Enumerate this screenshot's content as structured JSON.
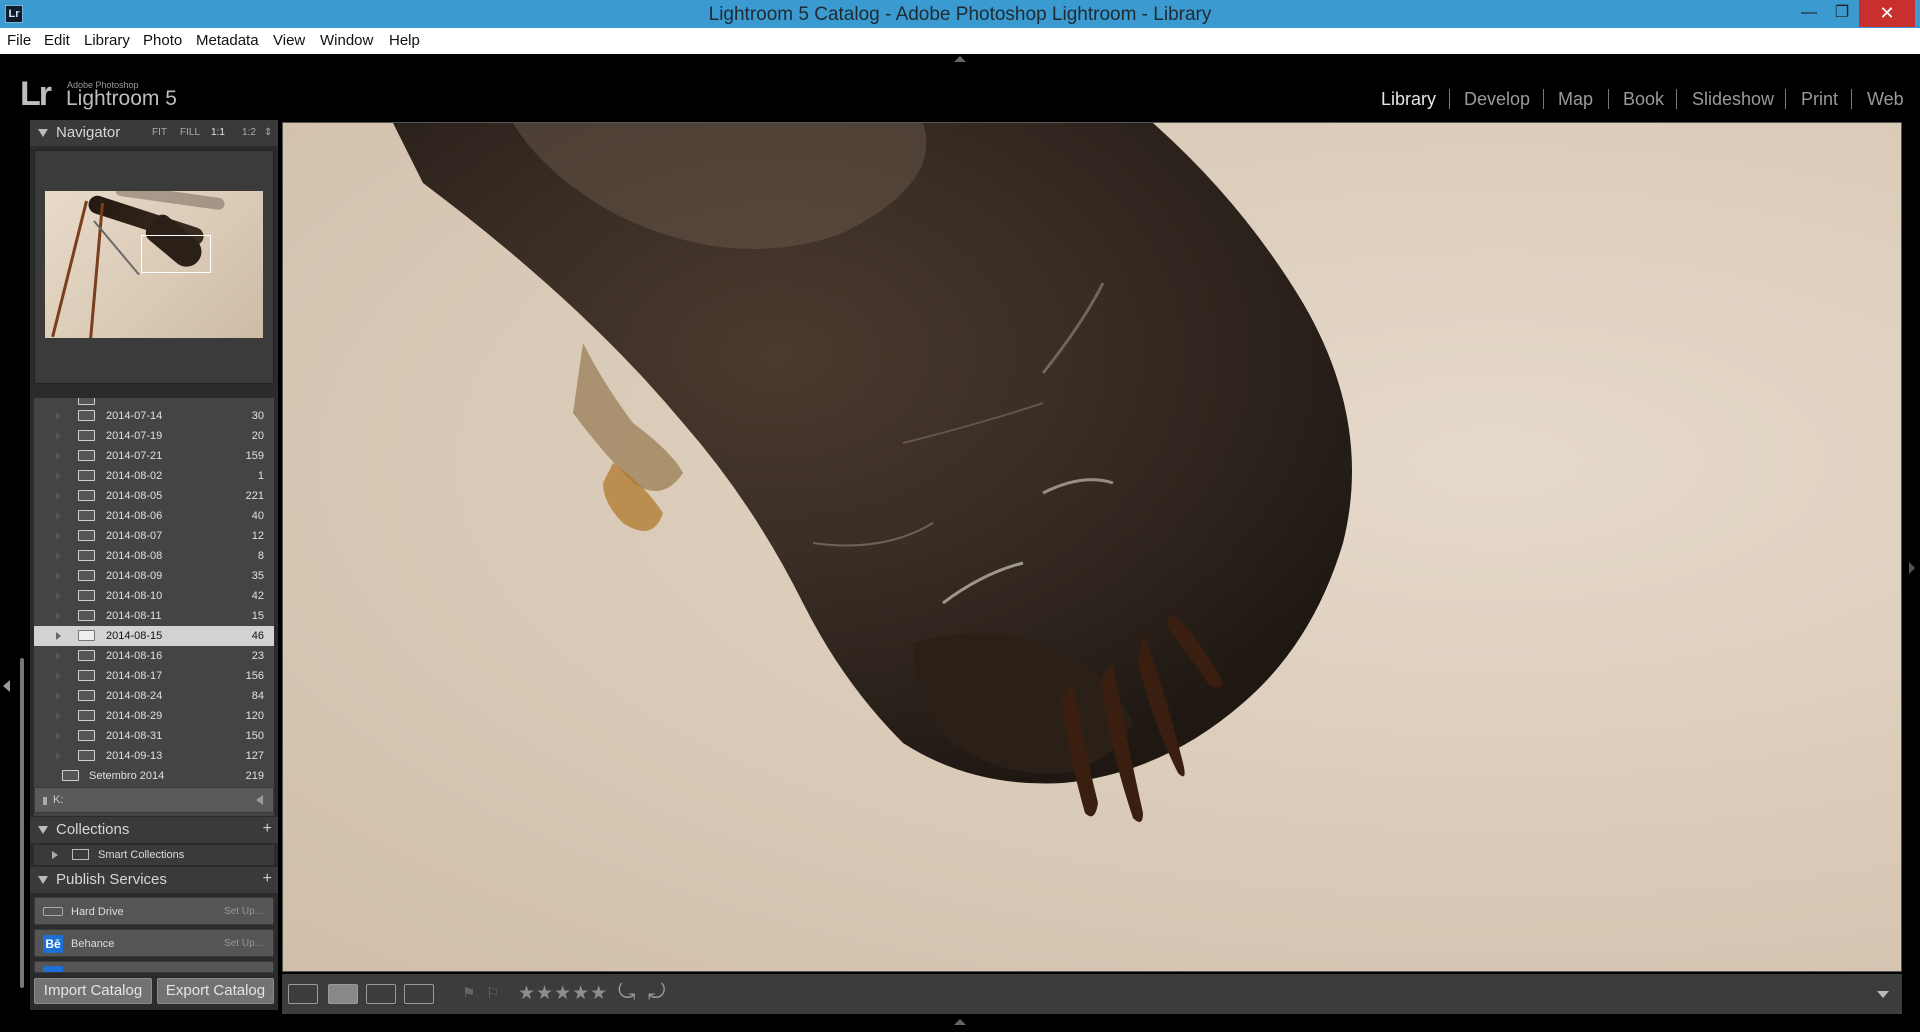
{
  "window": {
    "title": "Lightroom 5 Catalog - Adobe Photoshop Lightroom - Library",
    "app_icon": "Lr",
    "minimize": "—",
    "maximize": "❐",
    "close": "✕"
  },
  "menu": [
    "File",
    "Edit",
    "Library",
    "Photo",
    "Metadata",
    "View",
    "Window",
    "Help"
  ],
  "identity": {
    "logo": "Lr",
    "small": "Adobe Photoshop",
    "big": "Lightroom 5"
  },
  "modules": [
    "Library",
    "Develop",
    "Map",
    "Book",
    "Slideshow",
    "Print",
    "Web"
  ],
  "active_module": "Library",
  "navigator": {
    "title": "Navigator",
    "zoom": [
      "FIT",
      "FILL",
      "1:1",
      "1:2"
    ],
    "selected_zoom": "1:1"
  },
  "folders": [
    {
      "name": "2014-07-14",
      "count": "30"
    },
    {
      "name": "2014-07-19",
      "count": "20"
    },
    {
      "name": "2014-07-21",
      "count": "159"
    },
    {
      "name": "2014-08-02",
      "count": "1"
    },
    {
      "name": "2014-08-05",
      "count": "221"
    },
    {
      "name": "2014-08-06",
      "count": "40"
    },
    {
      "name": "2014-08-07",
      "count": "12"
    },
    {
      "name": "2014-08-08",
      "count": "8"
    },
    {
      "name": "2014-08-09",
      "count": "35"
    },
    {
      "name": "2014-08-10",
      "count": "42"
    },
    {
      "name": "2014-08-11",
      "count": "15"
    },
    {
      "name": "2014-08-15",
      "count": "46"
    },
    {
      "name": "2014-08-16",
      "count": "23"
    },
    {
      "name": "2014-08-17",
      "count": "156"
    },
    {
      "name": "2014-08-24",
      "count": "84"
    },
    {
      "name": "2014-08-29",
      "count": "120"
    },
    {
      "name": "2014-08-31",
      "count": "150"
    },
    {
      "name": "2014-09-13",
      "count": "127"
    }
  ],
  "selected_folder": "2014-08-15",
  "month_folder": {
    "name": "Setembro 2014",
    "count": "219"
  },
  "volume": {
    "label": "K:"
  },
  "collections": {
    "title": "Collections",
    "plus": "+",
    "items": [
      "Smart Collections"
    ]
  },
  "publish": {
    "title": "Publish Services",
    "plus": "+",
    "services": [
      {
        "name": "Hard Drive",
        "action": "Set Up..."
      },
      {
        "name": "Behance",
        "action": "Set Up...",
        "icon": "Bē"
      }
    ]
  },
  "buttons": {
    "import": "Import Catalog",
    "export": "Export Catalog"
  },
  "toolbar": {
    "stars": "★★★★★",
    "flag_pick": "⚑",
    "flag_reject": "⚐",
    "rotate_left": "⤿",
    "rotate_right": "⤾",
    "grid_icon": "grid-view-icon",
    "loupe_icon": "loupe-view-icon",
    "compare_icon": "compare-view-icon",
    "survey_icon": "survey-view-icon"
  }
}
